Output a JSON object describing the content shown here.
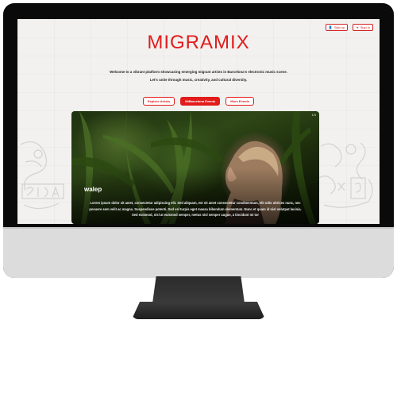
{
  "site": {
    "logo": "MIGRAMIX",
    "auth": {
      "signup_label": "Sign up",
      "signin_label": "Sign in",
      "signup_icon": "user-plus-icon",
      "signin_icon": "login-icon"
    },
    "intro": {
      "line1": "Welcome to a vibrant platform showcasing emerging migrant artists in Barcelona's electronic music scene.",
      "line2": "Let's unite through music, creativity, and cultural diversity."
    },
    "ctas": {
      "explore": "Explore Artists",
      "events": "MiBarcelona Events",
      "more": "More Events"
    },
    "featured": {
      "name": "walep",
      "bio": "Lorem ipsum dolor sit amet, consectetur adipiscing elit. Sed aliquam, est sit amet consectetur condimentum, elit odio ultrices nunc, nec posuere sem velit ac magna. Suspendisse potenti. Sed vel turpis eget massa bibendum elementum. Nunc et quam id nisl volutpat lacinia. Sed euismod, nisl at euismod semper, metus nisl semper augue, a tincidunt mi tor"
    }
  },
  "colors": {
    "accent": "#e21b1b",
    "screen_bg": "#f2f1ef",
    "monitor": "#0a0a0a",
    "chin": "#dcdcdc",
    "stand": "#2b2b2b"
  }
}
